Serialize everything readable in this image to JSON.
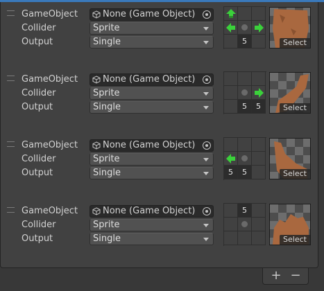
{
  "labels": {
    "gameobject": "GameObject",
    "collider": "Collider",
    "output": "Output"
  },
  "footer": {
    "add": "+",
    "remove": "−"
  },
  "entries": [
    {
      "object_value": "None (Game Object)",
      "collider_value": "Sprite",
      "output_value": "Single",
      "select_label": "Select",
      "grid": [
        "up-arrow",
        "",
        "",
        "left-arrow",
        "center",
        "right-arrow",
        "",
        "5",
        ""
      ],
      "sprite_shape": "full"
    },
    {
      "object_value": "None (Game Object)",
      "collider_value": "Sprite",
      "output_value": "Single",
      "select_label": "Select",
      "grid": [
        "",
        "",
        "",
        "",
        "center",
        "right-arrow",
        "",
        "5",
        "5"
      ],
      "sprite_shape": "top-left"
    },
    {
      "object_value": "None (Game Object)",
      "collider_value": "Sprite",
      "output_value": "Single",
      "select_label": "Select",
      "grid": [
        "",
        "",
        "",
        "left-arrow",
        "center",
        "",
        "5",
        "5",
        ""
      ],
      "sprite_shape": "top-right"
    },
    {
      "object_value": "None (Game Object)",
      "collider_value": "Sprite",
      "output_value": "Single",
      "select_label": "Select",
      "grid": [
        "",
        "5",
        "",
        "",
        "center",
        "",
        "",
        "",
        ""
      ],
      "sprite_shape": "bottom"
    }
  ],
  "colors": {
    "arrow": "#3bd13b",
    "sprite": "#a9683f",
    "accent": "#3a79bb"
  }
}
